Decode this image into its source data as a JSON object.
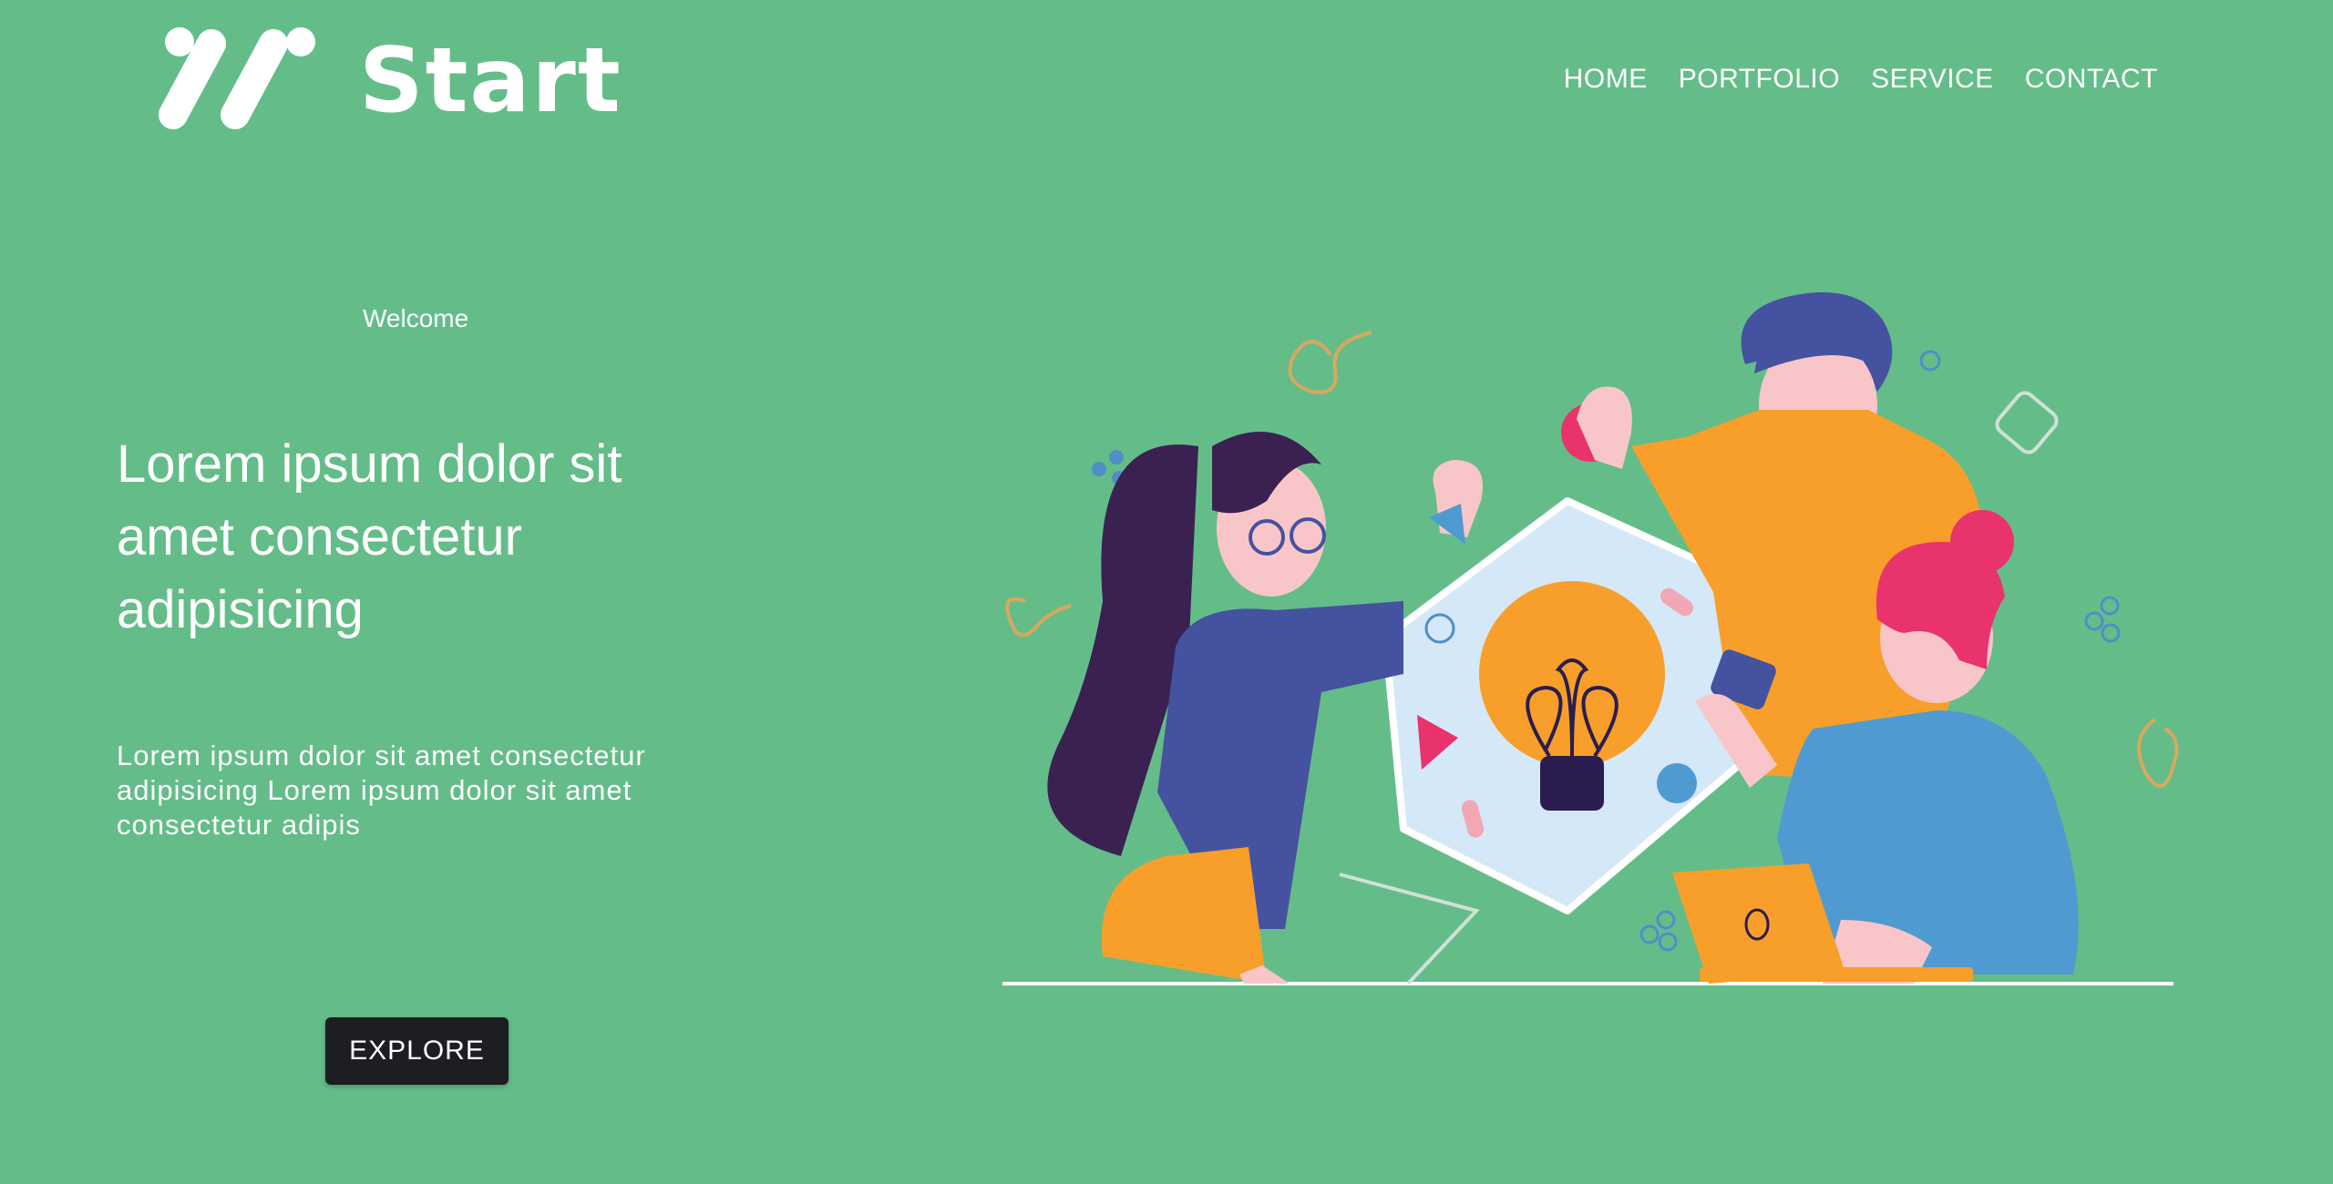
{
  "brand": {
    "name": "Start",
    "logo_icon": "slash-logo-icon"
  },
  "nav": {
    "items": [
      {
        "label": "HOME"
      },
      {
        "label": "PORTFOLIO"
      },
      {
        "label": "SERVICE"
      },
      {
        "label": "CONTACT"
      }
    ]
  },
  "hero": {
    "eyebrow": "Welcome",
    "headline": "Lorem ipsum dolor sit amet consectetur adipisicing",
    "body": "Lorem ipsum dolor sit amet consectetur adipisicing Lorem ipsum dolor sit amet consectetur adipis",
    "cta_label": "EXPLORE",
    "illustration": "team-idea-lightbulb-illustration"
  },
  "colors": {
    "background": "#64bd89",
    "button": "#1c1e21",
    "text": "#ffffff",
    "accent_orange": "#f79f2a",
    "accent_blue": "#4452a0",
    "accent_pink": "#e8336d"
  }
}
